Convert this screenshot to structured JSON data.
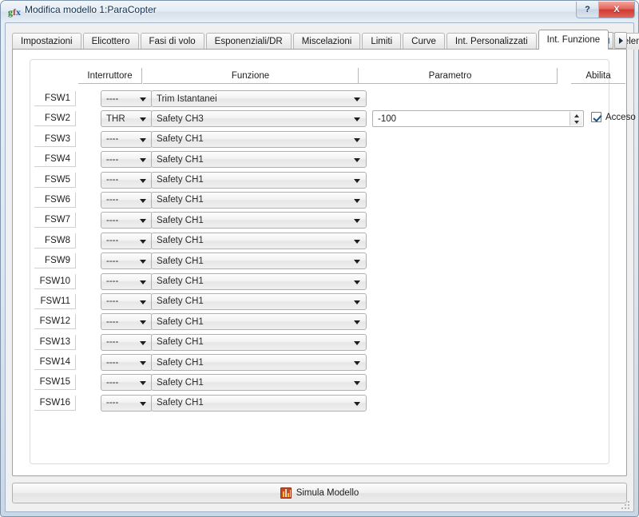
{
  "window": {
    "title": "Modifica modello 1:ParaCopter",
    "app_icon": "gfx-icon",
    "help_button": "?",
    "close_button": "X"
  },
  "tabs": {
    "items": [
      {
        "label": "Impostazioni",
        "active": false
      },
      {
        "label": "Elicottero",
        "active": false
      },
      {
        "label": "Fasi di volo",
        "active": false
      },
      {
        "label": "Esponenziali/DR",
        "active": false
      },
      {
        "label": "Miscelazioni",
        "active": false
      },
      {
        "label": "Limiti",
        "active": false
      },
      {
        "label": "Curve",
        "active": false
      },
      {
        "label": "Int. Personalizzati",
        "active": false
      },
      {
        "label": "Int. Funzione",
        "active": true
      },
      {
        "label": "Telemetria",
        "active": false
      }
    ],
    "scroll_left": "◀",
    "scroll_right": "▶"
  },
  "table": {
    "headers": {
      "switch": "Interruttore",
      "function": "Funzione",
      "parameter": "Parametro",
      "enable": "Abilita"
    },
    "empty_switch": "----",
    "rows": [
      {
        "id": "FSW1",
        "switch": "----",
        "function": "Trim Istantanei",
        "parameter": "",
        "has_parameter": false,
        "enabled": false,
        "enable_label": ""
      },
      {
        "id": "FSW2",
        "switch": "THR",
        "function": "Safety CH3",
        "parameter": "-100",
        "has_parameter": true,
        "enabled": true,
        "enable_label": "Acceso"
      },
      {
        "id": "FSW3",
        "switch": "----",
        "function": "Safety CH1",
        "parameter": "",
        "has_parameter": false,
        "enabled": false,
        "enable_label": ""
      },
      {
        "id": "FSW4",
        "switch": "----",
        "function": "Safety CH1",
        "parameter": "",
        "has_parameter": false,
        "enabled": false,
        "enable_label": ""
      },
      {
        "id": "FSW5",
        "switch": "----",
        "function": "Safety CH1",
        "parameter": "",
        "has_parameter": false,
        "enabled": false,
        "enable_label": ""
      },
      {
        "id": "FSW6",
        "switch": "----",
        "function": "Safety CH1",
        "parameter": "",
        "has_parameter": false,
        "enabled": false,
        "enable_label": ""
      },
      {
        "id": "FSW7",
        "switch": "----",
        "function": "Safety CH1",
        "parameter": "",
        "has_parameter": false,
        "enabled": false,
        "enable_label": ""
      },
      {
        "id": "FSW8",
        "switch": "----",
        "function": "Safety CH1",
        "parameter": "",
        "has_parameter": false,
        "enabled": false,
        "enable_label": ""
      },
      {
        "id": "FSW9",
        "switch": "----",
        "function": "Safety CH1",
        "parameter": "",
        "has_parameter": false,
        "enabled": false,
        "enable_label": ""
      },
      {
        "id": "FSW10",
        "switch": "----",
        "function": "Safety CH1",
        "parameter": "",
        "has_parameter": false,
        "enabled": false,
        "enable_label": ""
      },
      {
        "id": "FSW11",
        "switch": "----",
        "function": "Safety CH1",
        "parameter": "",
        "has_parameter": false,
        "enabled": false,
        "enable_label": ""
      },
      {
        "id": "FSW12",
        "switch": "----",
        "function": "Safety CH1",
        "parameter": "",
        "has_parameter": false,
        "enabled": false,
        "enable_label": ""
      },
      {
        "id": "FSW13",
        "switch": "----",
        "function": "Safety CH1",
        "parameter": "",
        "has_parameter": false,
        "enabled": false,
        "enable_label": ""
      },
      {
        "id": "FSW14",
        "switch": "----",
        "function": "Safety CH1",
        "parameter": "",
        "has_parameter": false,
        "enabled": false,
        "enable_label": ""
      },
      {
        "id": "FSW15",
        "switch": "----",
        "function": "Safety CH1",
        "parameter": "",
        "has_parameter": false,
        "enabled": false,
        "enable_label": ""
      },
      {
        "id": "FSW16",
        "switch": "----",
        "function": "Safety CH1",
        "parameter": "",
        "has_parameter": false,
        "enabled": false,
        "enable_label": ""
      }
    ]
  },
  "footer": {
    "simulate_label": "Simula Modello",
    "simulate_icon": "simulator-icon"
  },
  "colors": {
    "accent": "#1c4e8a",
    "close_red": "#cf3a30",
    "title_text": "#11304f",
    "frame": "#9fb3c8"
  }
}
